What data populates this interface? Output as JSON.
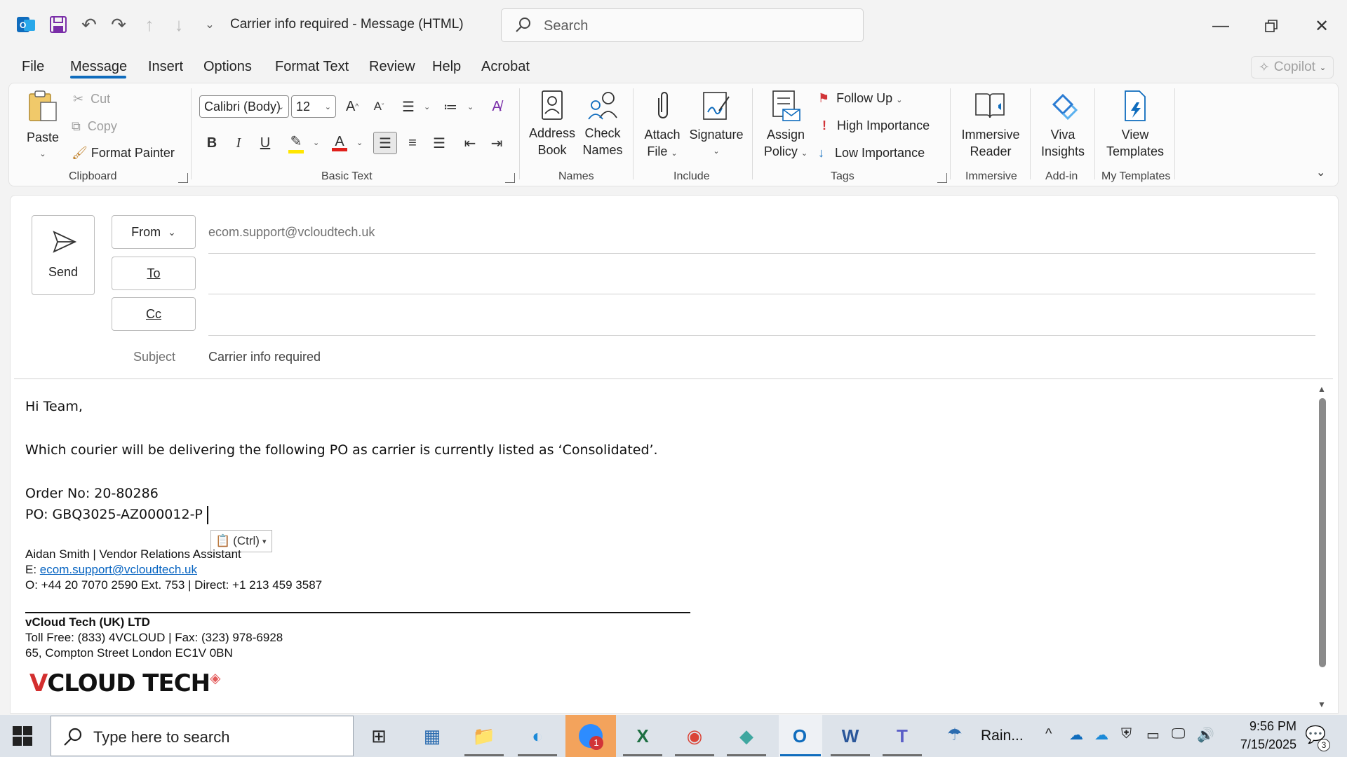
{
  "window": {
    "title": "Carrier info required  -  Message (HTML)",
    "search_placeholder": "Search"
  },
  "menu": {
    "tabs": [
      "File",
      "Message",
      "Insert",
      "Options",
      "Format Text",
      "Review",
      "Help",
      "Acrobat"
    ],
    "active": "Message",
    "copilot": "Copilot"
  },
  "ribbon": {
    "clipboard": {
      "paste": "Paste",
      "cut": "Cut",
      "copy": "Copy",
      "format_painter": "Format Painter",
      "label": "Clipboard"
    },
    "basic_text": {
      "font": "Calibri (Body)",
      "size": "12",
      "bold": "B",
      "italic": "I",
      "underline": "U",
      "label": "Basic Text"
    },
    "names": {
      "address_book_1": "Address",
      "address_book_2": "Book",
      "check_names_1": "Check",
      "check_names_2": "Names",
      "label": "Names"
    },
    "include": {
      "attach_1": "Attach",
      "attach_2": "File",
      "signature": "Signature",
      "label": "Include"
    },
    "tags": {
      "assign_1": "Assign",
      "assign_2": "Policy",
      "follow_up": "Follow Up",
      "high": "High Importance",
      "low": "Low Importance",
      "label": "Tags"
    },
    "immersive": {
      "reader_1": "Immersive",
      "reader_2": "Reader",
      "label": "Immersive"
    },
    "addin": {
      "viva_1": "Viva",
      "viva_2": "Insights",
      "label": "Add-in"
    },
    "templates": {
      "view_1": "View",
      "view_2": "Templates",
      "label": "My Templates"
    }
  },
  "compose": {
    "send": "Send",
    "from_label": "From",
    "from_value": "ecom.support@vcloudtech.uk",
    "to_label": "To",
    "cc_label": "Cc",
    "subject_label": "Subject",
    "subject_value": "Carrier info required"
  },
  "body": {
    "greeting": "Hi Team,",
    "line1": "Which courier will be delivering the following PO as carrier is currently listed as ‘Consolidated’.",
    "order": "Order No: 20-80286",
    "po": "PO: GBQ3025-AZ000012-P",
    "paste_options": "(Ctrl)"
  },
  "signature": {
    "name_line": "Aidan Smith | Vendor Relations Assistant",
    "email_prefix": "E: ",
    "email": "ecom.support@vcloudtech.uk",
    "office": "O:  +44 20 7070 2590 Ext. 753 | Direct: +1 213 459 3587",
    "company": "vCloud Tech (UK) LTD",
    "tollfree": "Toll Free: (833) 4VCLOUD | Fax: (323) 978-6928",
    "address": "65, Compton Street London EC1V 0BN",
    "logo_v": "V",
    "logo_rest": "CLOUD TECH"
  },
  "taskbar": {
    "search_placeholder": "Type here to search",
    "weather": "Rain...",
    "time": "9:56 PM",
    "date": "7/15/2025",
    "notifications": "3",
    "zoom_badge": "1"
  }
}
